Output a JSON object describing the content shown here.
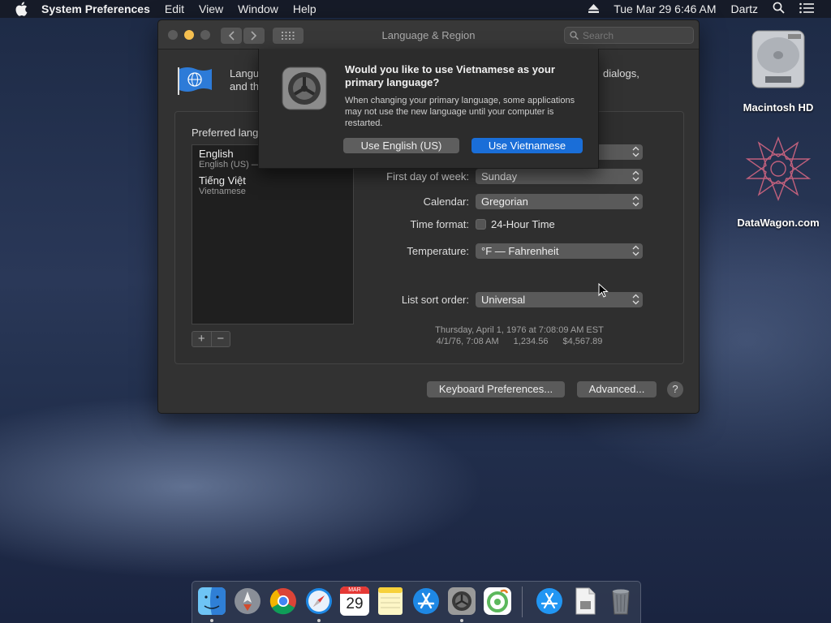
{
  "menubar": {
    "app_name": "System Preferences",
    "menus": [
      "Edit",
      "View",
      "Window",
      "Help"
    ],
    "clock": "Tue Mar 29  6:46 AM",
    "user": "Dartz"
  },
  "window": {
    "title": "Language & Region",
    "search_placeholder": "Search",
    "header_text": "Langu…",
    "header_text2": "and th",
    "header_tail": "dialogs,",
    "preferred_label": "Preferred lang",
    "languages": [
      {
        "name": "English",
        "sub": "English (US) —"
      },
      {
        "name": "Tiếng Việt",
        "sub": "Vietnamese"
      }
    ],
    "settings": {
      "first_day_label": "First day of week:",
      "first_day_value": "Sunday",
      "calendar_label": "Calendar:",
      "calendar_value": "Gregorian",
      "time_format_label": "Time format:",
      "time_format_value": "24-Hour Time",
      "temperature_label": "Temperature:",
      "temperature_value": "°F — Fahrenheit",
      "list_sort_label": "List sort order:",
      "list_sort_value": "Universal"
    },
    "sample_date": "Thursday, April 1, 1976 at 7:08:09 AM EST",
    "sample_short": "4/1/76, 7:08 AM",
    "sample_number": "1,234.56",
    "sample_currency": "$4,567.89",
    "keyboard_button": "Keyboard Preferences...",
    "advanced_button": "Advanced...",
    "help_button": "?"
  },
  "sheet": {
    "title": "Would you like to use Vietnamese as your primary language?",
    "message": "When changing your primary language, some applications may not use the new language until your computer is restarted.",
    "secondary_button": "Use English (US)",
    "primary_button": "Use Vietnamese"
  },
  "desktop": {
    "icons": [
      {
        "label": "Macintosh HD"
      },
      {
        "label": "DataWagon.com"
      }
    ]
  },
  "dock": {
    "calendar_month": "MAR",
    "calendar_day": "29"
  },
  "colors": {
    "accent": "#1a6ed8",
    "close": "#5b5b5b",
    "minimize": "#f5bf4f"
  }
}
